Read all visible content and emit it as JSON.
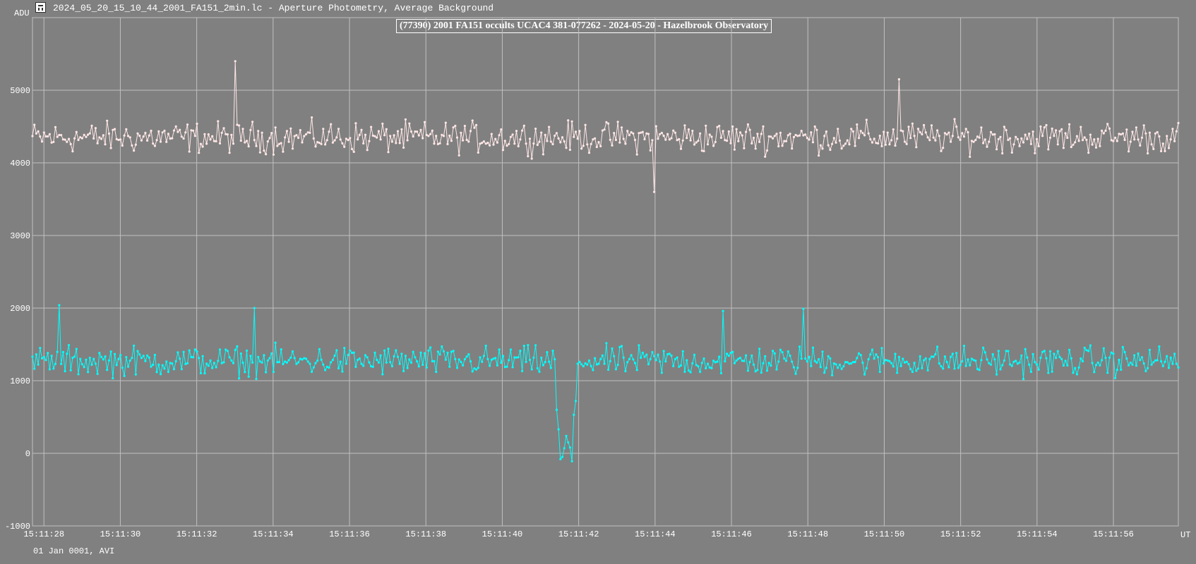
{
  "window": {
    "file_title": "2024_05_20_15_10_44_2001_FA151_2min.lc - Aperture Photometry, Average Background"
  },
  "footer": {
    "date_label": "01 Jan 0001, AVI"
  },
  "colors": {
    "background": "#808080",
    "grid": "#c0c0c0",
    "comparison_star": "#ffe6e6",
    "target_star": "#00ffff"
  },
  "chart_data": {
    "type": "line",
    "title": "(77390) 2001 FA151 occults UCAC4 381-077262 - 2024-05-20 - Hazelbrook Observatory",
    "ylabel": "ADU",
    "xlabel": "UT",
    "ylim": [
      -1000,
      6000
    ],
    "xlim_seconds": [
      27.7,
      57.7
    ],
    "y_ticks": [
      "-1000",
      "0",
      "1000",
      "2000",
      "3000",
      "4000",
      "5000"
    ],
    "y_tick_values": [
      -1000,
      0,
      1000,
      2000,
      3000,
      4000,
      5000
    ],
    "x_tick_labels": [
      "15:11:28",
      "15:11:30",
      "15:11:32",
      "15:11:34",
      "15:11:36",
      "15:11:38",
      "15:11:40",
      "15:11:42",
      "15:11:44",
      "15:11:46",
      "15:11:48",
      "15:11:50",
      "15:11:52",
      "15:11:54",
      "15:11:56"
    ],
    "x_tick_seconds": [
      28,
      30,
      32,
      34,
      36,
      38,
      40,
      42,
      44,
      46,
      48,
      50,
      52,
      54,
      56
    ],
    "grid": true,
    "samples": 600,
    "series": [
      {
        "key": "comparison",
        "color": "#ffe6e6",
        "baseline": 4350,
        "noise": 220,
        "features": [
          {
            "t": 33.0,
            "value": 5400
          },
          {
            "t": 50.4,
            "value": 5150
          },
          {
            "t": 44.0,
            "value": 3600
          }
        ]
      },
      {
        "key": "target",
        "color": "#00ffff",
        "baseline": 1270,
        "noise": 210,
        "features": [
          {
            "t": 41.4,
            "value": 600
          },
          {
            "t": 41.45,
            "value": 330
          },
          {
            "t": 41.5,
            "value": -80
          },
          {
            "t": 41.55,
            "value": -50
          },
          {
            "t": 41.6,
            "value": 70
          },
          {
            "t": 41.65,
            "value": 240
          },
          {
            "t": 41.7,
            "value": 150
          },
          {
            "t": 41.75,
            "value": 80
          },
          {
            "t": 41.8,
            "value": -110
          },
          {
            "t": 41.85,
            "value": 530
          },
          {
            "t": 41.9,
            "value": 720
          },
          {
            "t": 28.4,
            "value": 2040
          },
          {
            "t": 33.5,
            "value": 2000
          },
          {
            "t": 45.8,
            "value": 1960
          },
          {
            "t": 47.9,
            "value": 1990
          }
        ]
      }
    ]
  }
}
